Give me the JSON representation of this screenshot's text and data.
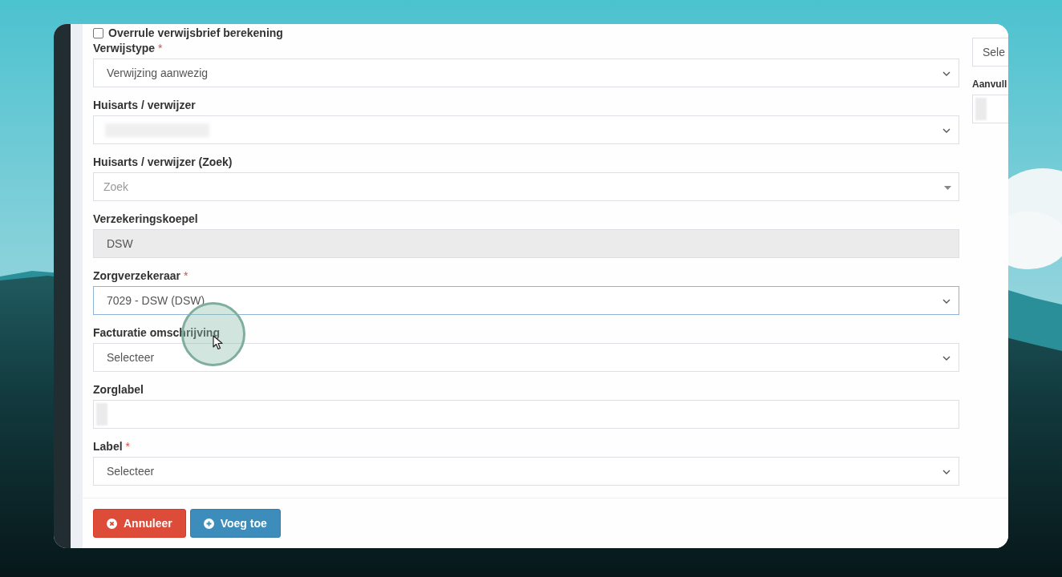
{
  "checkbox": {
    "label": "Overrule verwijsbrief berekening",
    "checked": false
  },
  "fields": [
    {
      "label": "Verwijstype",
      "required_mark": "*",
      "kind": "select",
      "value": "Verwijzing aanwezig",
      "disabled": false,
      "focused": false
    },
    {
      "label": "Huisarts / verwijzer",
      "kind": "select",
      "blurred": true,
      "disabled": false,
      "focused": false
    },
    {
      "label": "Huisarts / verwijzer (Zoek)",
      "kind": "search-select",
      "placeholder": "Zoek",
      "disabled": false,
      "focused": false
    },
    {
      "label": "Verzekeringskoepel",
      "kind": "input",
      "value": "DSW",
      "disabled": true,
      "focused": false
    },
    {
      "label": "Zorgverzekeraar",
      "required_mark": "*",
      "kind": "select",
      "value": "7029 - DSW (DSW)",
      "disabled": false,
      "focused": true
    },
    {
      "label": "Facturatie omschrijving",
      "kind": "select",
      "value": "Selecteer",
      "disabled": false,
      "focused": false
    },
    {
      "label": "Zorglabel",
      "kind": "input",
      "blurred": true,
      "disabled": false,
      "focused": false
    },
    {
      "label": "Label",
      "required_mark": "*",
      "kind": "select",
      "value": "Selecteer",
      "disabled": false,
      "focused": false
    }
  ],
  "side_fields": [
    {
      "value": "Sele"
    },
    {
      "label": "Aanvull",
      "blurred": true
    }
  ],
  "buttons": [
    {
      "kind": "cancel",
      "label": "Annuleer"
    },
    {
      "kind": "add",
      "label": "Voeg toe"
    }
  ]
}
